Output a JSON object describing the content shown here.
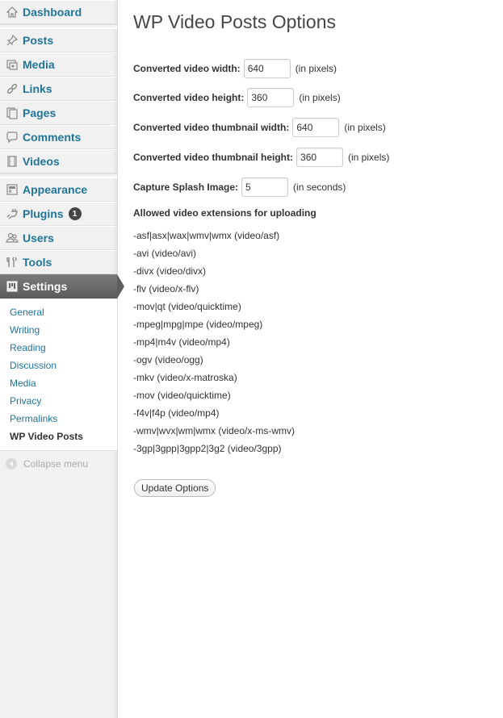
{
  "sidebar": {
    "menu": [
      {
        "label": "Dashboard",
        "icon": "dashboard-icon"
      },
      {
        "label": "Posts",
        "icon": "pin-icon"
      },
      {
        "label": "Media",
        "icon": "media-icon"
      },
      {
        "label": "Links",
        "icon": "link-icon"
      },
      {
        "label": "Pages",
        "icon": "pages-icon"
      },
      {
        "label": "Comments",
        "icon": "comment-icon"
      },
      {
        "label": "Videos",
        "icon": "video-icon"
      },
      {
        "label": "Appearance",
        "icon": "appearance-icon"
      },
      {
        "label": "Plugins",
        "icon": "plugin-icon",
        "badge": "1"
      },
      {
        "label": "Users",
        "icon": "users-icon"
      },
      {
        "label": "Tools",
        "icon": "tools-icon"
      },
      {
        "label": "Settings",
        "icon": "settings-icon"
      }
    ],
    "submenu": [
      {
        "label": "General"
      },
      {
        "label": "Writing"
      },
      {
        "label": "Reading"
      },
      {
        "label": "Discussion"
      },
      {
        "label": "Media"
      },
      {
        "label": "Privacy"
      },
      {
        "label": "Permalinks"
      },
      {
        "label": "WP Video Posts"
      }
    ],
    "collapse_label": "Collapse menu"
  },
  "main": {
    "title": "WP Video Posts Options",
    "fields": [
      {
        "label": "Converted video width:",
        "value": "640",
        "unit": "(in pixels)"
      },
      {
        "label": "Converted video height:",
        "value": "360",
        "unit": "(in pixels)"
      },
      {
        "label": "Converted video thumbnail width:",
        "value": "640",
        "unit": "(in pixels)"
      },
      {
        "label": "Converted video thumbnail height:",
        "value": "360",
        "unit": "(in pixels)"
      },
      {
        "label": "Capture Splash Image:",
        "value": "5",
        "unit": "(in seconds)"
      }
    ],
    "extensions_heading": "Allowed video extensions for uploading",
    "extensions": [
      "-asf|asx|wax|wmv|wmx (video/asf)",
      "-avi (video/avi)",
      "-divx (video/divx)",
      "-flv (video/x-flv)",
      "-mov|qt (video/quicktime)",
      "-mpeg|mpg|mpe (video/mpeg)",
      "-mp4|m4v (video/mp4)",
      "-ogv (video/ogg)",
      "-mkv (video/x-matroska)",
      "-mov (video/quicktime)",
      "-f4v|f4p (video/mp4)",
      "-wmv|wvx|wm|wmx (video/x-ms-wmv)",
      "-3gp|3gpp|3gpp2|3g2 (video/3gpp)"
    ],
    "update_button": "Update Options"
  },
  "colors": {
    "link": "#21759b",
    "active_menu": "#5c5c5c",
    "badge": "#464646",
    "title": "#464646"
  }
}
